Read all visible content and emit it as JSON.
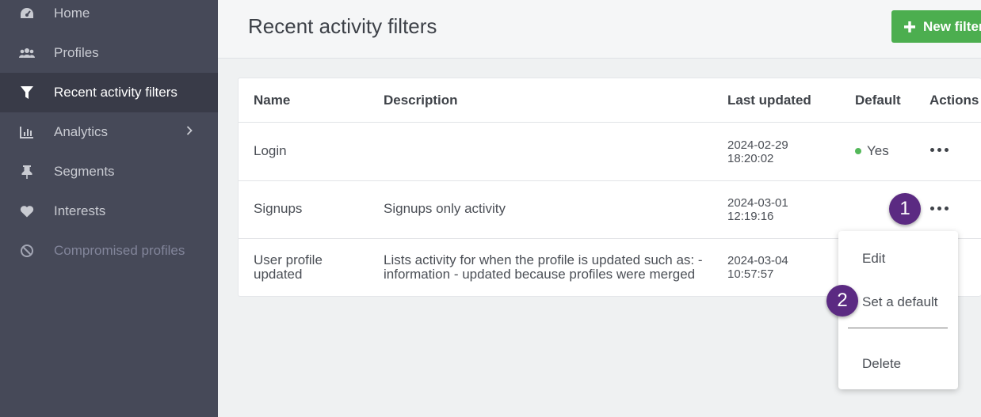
{
  "sidebar": {
    "items": [
      {
        "label": "Home",
        "icon": "dashboard-icon"
      },
      {
        "label": "Profiles",
        "icon": "users-icon"
      },
      {
        "label": "Recent activity filters",
        "icon": "filter-icon"
      },
      {
        "label": "Analytics",
        "icon": "bar-chart-icon"
      },
      {
        "label": "Segments",
        "icon": "pushpin-icon"
      },
      {
        "label": "Interests",
        "icon": "heart-icon"
      },
      {
        "label": "Compromised profiles",
        "icon": "ban-icon"
      }
    ]
  },
  "header": {
    "title": "Recent activity filters",
    "new_filter_label": "New filter"
  },
  "table": {
    "columns": [
      "Name",
      "Description",
      "Last updated",
      "Default",
      "Actions"
    ],
    "rows": [
      {
        "name": "Login",
        "description": "",
        "date": "2024-02-29",
        "time": "18:20:02",
        "default": "Yes"
      },
      {
        "name": "Signups",
        "description": "Signups only activity",
        "date": "2024-03-01",
        "time": "12:19:16",
        "default": ""
      },
      {
        "name_line1": "User profile",
        "name_line2": "updated",
        "desc_line1": "Lists activity for when the profile is updated such as: -",
        "desc_line2": "information - updated because profiles were merged",
        "date": "2024-03-04",
        "time": "10:57:57",
        "default": ""
      }
    ]
  },
  "menu": {
    "edit": "Edit",
    "set_default": "Set a default",
    "delete": "Delete"
  },
  "callouts": [
    "1",
    "2"
  ],
  "colors": {
    "sidebar_bg": "#464958",
    "sidebar_active": "#393b48",
    "primary_button": "#4cae4f",
    "callout": "#5b2a82",
    "default_dot": "#54b85a"
  }
}
